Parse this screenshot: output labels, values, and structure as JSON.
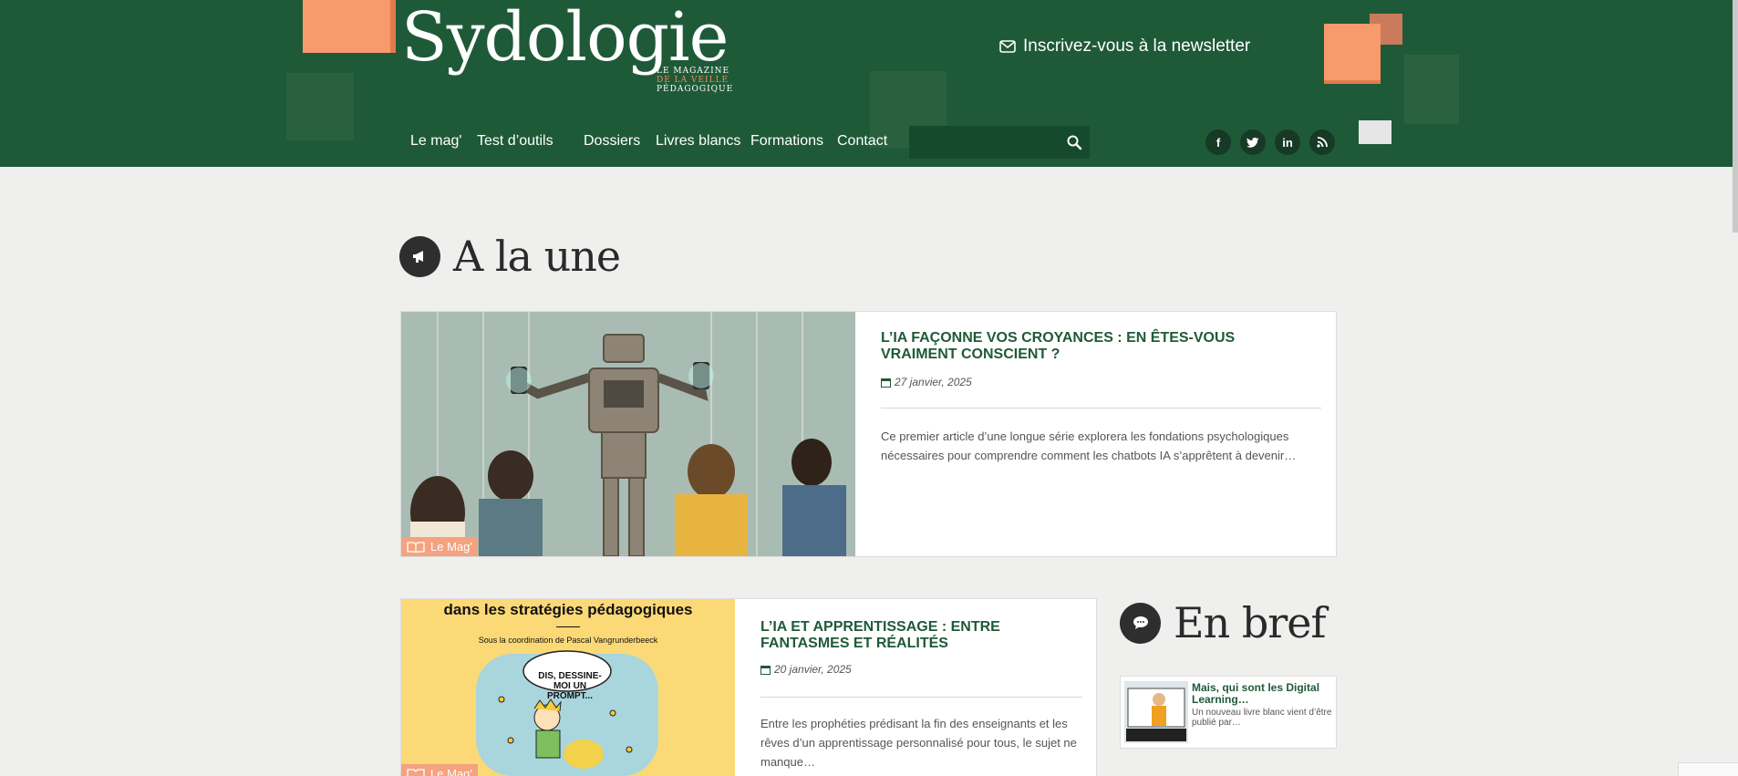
{
  "header": {
    "logo_text": "Sydologie",
    "tagline_line1": "LE MAGAZINE",
    "tagline_line2": "DE LA VEILLE",
    "tagline_line3": "PÉDAGOGIQUE",
    "newsletter_label": "Inscrivez-vous à la newsletter",
    "nav": [
      {
        "label": "Le mag'"
      },
      {
        "label": "Test d’outils"
      },
      {
        "label": "Dossiers"
      },
      {
        "label": "Livres blancs"
      },
      {
        "label": "Formations"
      },
      {
        "label": "Contact"
      }
    ],
    "search_placeholder": "",
    "social": [
      {
        "icon": "facebook-icon",
        "glyph": "f"
      },
      {
        "icon": "twitter-icon",
        "glyph": "t"
      },
      {
        "icon": "linkedin-icon",
        "glyph": "in"
      },
      {
        "icon": "rss-icon",
        "glyph": "rss"
      }
    ]
  },
  "sections": {
    "une_title": "A la une",
    "bref_title": "En bref"
  },
  "articles": [
    {
      "title": "L’IA FAÇONNE VOS CROYANCES : EN ÊTES-VOUS VRAIMENT CONSCIENT ?",
      "date": "27 janvier, 2025",
      "excerpt": "Ce premier article d’une longue série explorera les fondations psychologiques nécessaires pour comprendre comment les chatbots IA s’apprêtent à devenir…",
      "category": "Le Mag'"
    },
    {
      "title": "L’IA ET APPRENTISSAGE : ENTRE FANTASMES ET RÉALITÉS",
      "date": "20 janvier, 2025",
      "excerpt": "Entre les prophéties prédisant la fin des enseignants et les rêves d’un apprentissage personnalisé pour tous, le sujet ne manque…",
      "category": "Le Mag'",
      "cover_heading": "dans les stratégies pédagogiques",
      "cover_sub": "Sous la coordination de Pascal Vangrunderbeeck",
      "cover_bubble": "DIS, DESSINE-MOI UN PROMPT..."
    }
  ],
  "brief": [
    {
      "title": "Mais, qui sont les Digital Learning…",
      "text": "Un nouveau livre blanc vient d’être publié par…"
    }
  ],
  "colors": {
    "header_green": "#1f5a38",
    "accent_orange": "#f4a27f",
    "title_green": "#1f5a38"
  }
}
